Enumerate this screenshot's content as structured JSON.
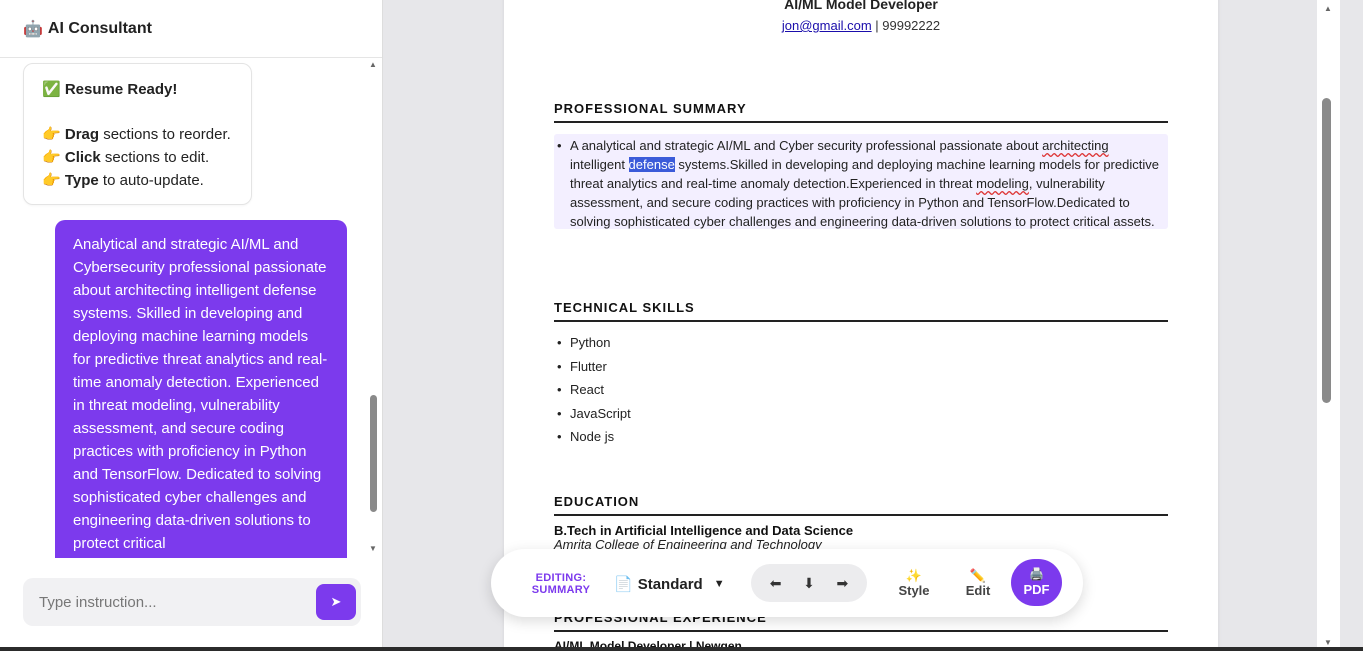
{
  "sidebar": {
    "title_emoji": "🤖",
    "title": "AI Consultant",
    "bot_message": {
      "title": "✅ Resume Ready!",
      "lines": [
        {
          "emoji": "👉",
          "bold": "Drag",
          "rest": " sections to reorder."
        },
        {
          "emoji": "👉",
          "bold": "Click",
          "rest": " sections to edit."
        },
        {
          "emoji": "👉",
          "bold": "Type",
          "rest": " to auto-update."
        }
      ]
    },
    "user_message": "Analytical and strategic AI/ML and Cybersecurity professional passionate about architecting intelligent defense systems. Skilled in developing and deploying machine learning models for predictive threat analytics and real-time anomaly detection. Experienced in threat modeling, vulnerability assessment, and secure coding practices with proficiency in Python and TensorFlow. Dedicated to solving sophisticated cyber challenges and engineering data-driven solutions to protect critical",
    "input_placeholder": "Type instruction...",
    "send_icon": "➤"
  },
  "resume": {
    "role": "AI/ML Model Developer",
    "email": "jon@gmail.com",
    "contact_sep": " | ",
    "phone": "99992222",
    "sections": {
      "summary_title": "PROFESSIONAL SUMMARY",
      "summary_parts": {
        "p1": "A analytical and strategic AI/ML and Cyber security professional passionate about ",
        "p2": "architecting",
        "p3": " intelligent ",
        "p4": "defense",
        "p5": " systems.Skilled in developing and deploying machine learning models for predictive threat analytics and real-time anomaly detection.Experienced in threat ",
        "p6": "modeling",
        "p7": ", vulnerability assessment, and secure coding practices with proficiency in Python and TensorFlow.Dedicated to solving sophisticated cyber challenges and engineering data-driven solutions to protect critical assets."
      },
      "skills_title": "TECHNICAL SKILLS",
      "skills": [
        "Python",
        "Flutter",
        "React",
        "JavaScript",
        "Node js"
      ],
      "education_title": "EDUCATION",
      "degree": "B.Tech in Artificial Intelligence and Data Science",
      "college": "Amrita College of Engineering and Technology",
      "experience_title": "PROFESSIONAL EXPERIENCE",
      "experience_first": "AI/ML Model Developer | Newgen"
    }
  },
  "toolbar": {
    "editing_label_1": "EDITING:",
    "editing_label_2": "SUMMARY",
    "template_icon": "📄",
    "template_value": "Standard",
    "chevron": "⌄",
    "move_left": "⬅",
    "move_down": "⬇",
    "move_right": "➡",
    "style_icon": "✨",
    "style_label": "Style",
    "edit_icon": "✏️",
    "edit_label": "Edit",
    "pdf_icon": "🖨️",
    "pdf_label": "PDF"
  },
  "colors": {
    "accent": "#7c3aed",
    "selection": "#3b5bd9",
    "summary_highlight": "#f3efff"
  }
}
